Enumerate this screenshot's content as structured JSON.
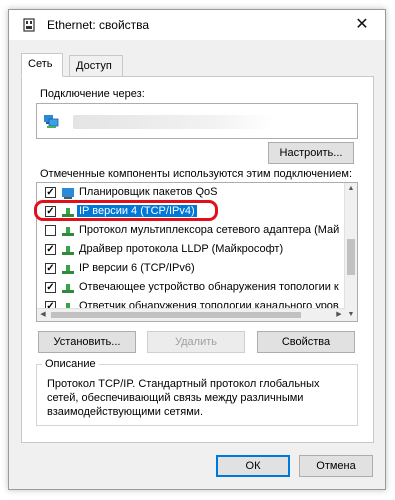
{
  "window": {
    "title": "Ethernet: свойства",
    "close_glyph": "✕"
  },
  "tabs": [
    {
      "label": "Сеть"
    },
    {
      "label": "Доступ"
    }
  ],
  "connect": {
    "label": "Подключение через:",
    "configure_button": "Настроить..."
  },
  "components": {
    "label": "Отмеченные компоненты используются этим подключением:",
    "items": [
      {
        "label": "Планировщик пакетов QoS",
        "checked": true,
        "icon": "network-service-icon"
      },
      {
        "label": "IP версии 4 (TCP/IPv4)",
        "checked": true,
        "icon": "protocol-icon",
        "selected": true
      },
      {
        "label": "Протокол мультиплексора сетевого адаптера (Май",
        "checked": false,
        "icon": "protocol-icon"
      },
      {
        "label": "Драйвер протокола LLDP (Майкрософт)",
        "checked": true,
        "icon": "protocol-icon"
      },
      {
        "label": "IP версии 6 (TCP/IPv6)",
        "checked": true,
        "icon": "protocol-icon"
      },
      {
        "label": "Отвечающее устройство обнаружения топологии к",
        "checked": true,
        "icon": "protocol-icon"
      },
      {
        "label": "Ответчик обнаружения топологии канального уров",
        "checked": true,
        "icon": "protocol-icon"
      }
    ]
  },
  "buttons": {
    "install": "Установить...",
    "remove": "Удалить",
    "properties": "Свойства"
  },
  "description": {
    "legend": "Описание",
    "text": "Протокол TCP/IP. Стандартный протокол глобальных сетей, обеспечивающий связь между различными взаимодействующими сетями."
  },
  "footer": {
    "ok": "ОК",
    "cancel": "Отмена"
  },
  "colors": {
    "accent": "#0078d7",
    "highlight_ring": "#e0101a"
  }
}
